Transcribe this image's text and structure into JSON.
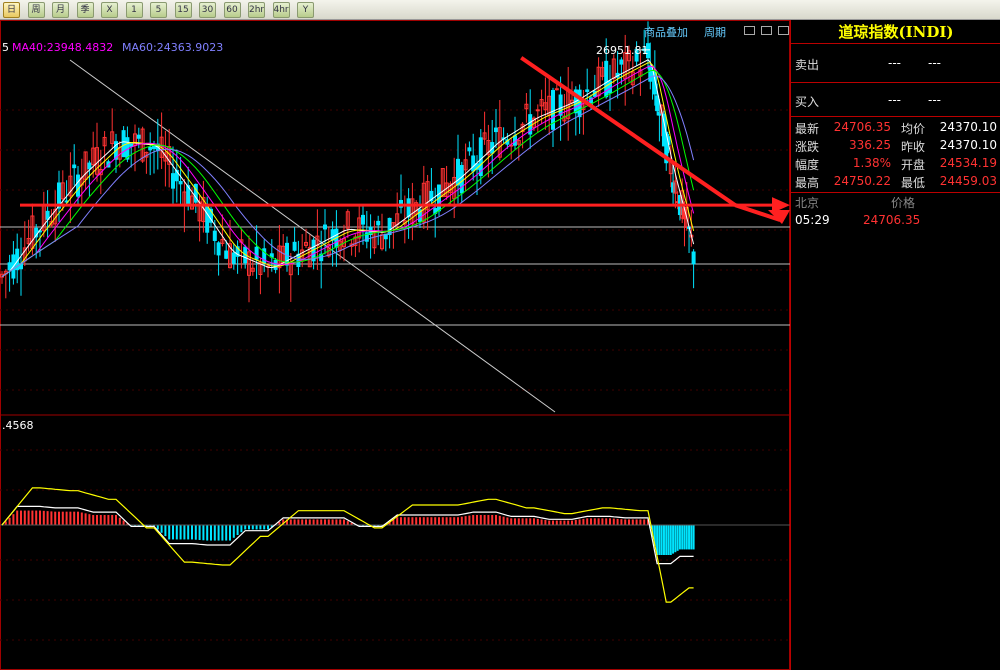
{
  "toolbar": {
    "buttons": [
      "日",
      "周",
      "月",
      "季",
      "X",
      "1",
      "5",
      "15",
      "30",
      "60",
      "2hr",
      "4hr",
      "Y"
    ]
  },
  "chart_header": {
    "ma_legend": [
      {
        "text": "5",
        "color": "#ffffff"
      },
      {
        "text": "MA40:23948.4832",
        "color": "#ff00ff"
      },
      {
        "text": "MA60:24363.9023",
        "color": "#8080ff"
      }
    ],
    "overlay_link": "商品叠加",
    "period_link": "周期"
  },
  "indicator_header": ".4568",
  "panel": {
    "title": "道琼指数(INDI)",
    "sell_label": "卖出",
    "sell_values": [
      "---",
      "---"
    ],
    "buy_label": "买入",
    "buy_values": [
      "---",
      "---"
    ],
    "quotes": [
      {
        "l1": "最新",
        "v1": "24706.35",
        "c1": "#ff3232",
        "l2": "均价",
        "v2": "24370.10",
        "c2": "#ffffff"
      },
      {
        "l1": "涨跌",
        "v1": "336.25",
        "c1": "#ff3232",
        "l2": "昨收",
        "v2": "24370.10",
        "c2": "#ffffff"
      },
      {
        "l1": "幅度",
        "v1": "1.38%",
        "c1": "#ff3232",
        "l2": "开盘",
        "v2": "24534.19",
        "c2": "#ff3232"
      },
      {
        "l1": "最高",
        "v1": "24750.22",
        "c1": "#ff3232",
        "l2": "最低",
        "v2": "24459.03",
        "c2": "#ff3232"
      }
    ],
    "tick_header": {
      "time_label": "北京",
      "price_label": "价格"
    },
    "tick": {
      "time": "05:29",
      "price": "24706.35"
    }
  },
  "chart_data": {
    "type": "line",
    "title": "",
    "xlabel": "",
    "ylabel": "",
    "peak_label": "26951.81",
    "ylim": [
      22500,
      27300
    ],
    "colors": {
      "up": "#ff3232",
      "down": "#00e5ff",
      "trendline": "#ff2020",
      "support": "#ffffff"
    },
    "price_series": [
      {
        "name": "",
        "x": [
          0,
          0.05,
          0.1,
          0.15,
          0.2,
          0.25,
          0.3,
          0.35,
          0.4,
          0.45,
          0.5,
          0.55,
          0.6,
          0.65,
          0.7,
          0.75,
          0.8,
          0.85,
          0.88,
          0.91
        ],
        "values": [
          24200,
          24850,
          25450,
          25900,
          25850,
          25200,
          24500,
          24300,
          24550,
          24800,
          24750,
          25100,
          25450,
          25900,
          26200,
          26400,
          26700,
          26950,
          25600,
          24500
        ]
      }
    ],
    "annotations": [
      {
        "type": "trendline",
        "from": [
          0.67,
          26951.81
        ],
        "to": [
          0.98,
          25100
        ],
        "color": "#ff2020"
      },
      {
        "type": "hline",
        "value": 25100,
        "color": "#ff2020"
      },
      {
        "type": "hline",
        "value": 24700,
        "color": "#ffffff"
      }
    ]
  }
}
